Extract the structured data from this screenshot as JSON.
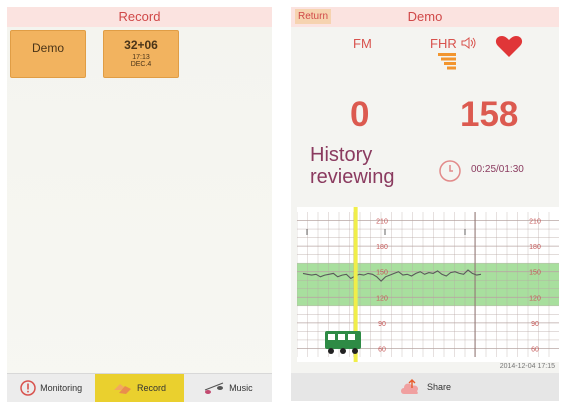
{
  "left": {
    "title": "Record",
    "cards": [
      {
        "name": "Demo"
      },
      {
        "weeks": "32+06",
        "time": "17:13",
        "date": "DEC.4"
      }
    ],
    "nav": [
      {
        "label": "Monitoring",
        "icon": "exclamation-icon"
      },
      {
        "label": "Record",
        "icon": "hands-icon"
      },
      {
        "label": "Music",
        "icon": "music-note-icon"
      }
    ]
  },
  "right": {
    "title": "Demo",
    "return_label": "Return",
    "fm_label": "FM",
    "fhr_label": "FHR",
    "fm_value": "0",
    "fhr_value": "158",
    "status": [
      "History",
      "reviewing"
    ],
    "progress": "00:25/01:30",
    "timestamp": "2014-12-04 17:15",
    "share_label": "Share"
  },
  "chart_data": {
    "type": "line",
    "title": "",
    "ylim": [
      50,
      220
    ],
    "yticks": [
      210,
      180,
      150,
      120,
      90,
      60
    ],
    "normal_band": [
      110,
      160
    ],
    "cursor_x": 0.22,
    "series": [
      {
        "values": [
          148,
          147,
          146,
          147,
          144,
          146,
          147,
          148,
          144,
          146,
          147,
          142,
          145,
          147,
          146,
          148,
          147,
          144,
          139,
          144,
          146,
          148,
          150,
          146,
          147,
          145,
          148,
          150,
          147,
          149,
          148,
          151,
          147,
          145,
          149,
          150,
          148,
          147,
          152,
          148,
          146,
          147
        ]
      }
    ],
    "colors": {
      "line": "#5a5a5a",
      "grid": "#b8a7a4",
      "band": "#8bd47d",
      "cursor": "#f0ee4a",
      "tick": "#c55858"
    }
  }
}
